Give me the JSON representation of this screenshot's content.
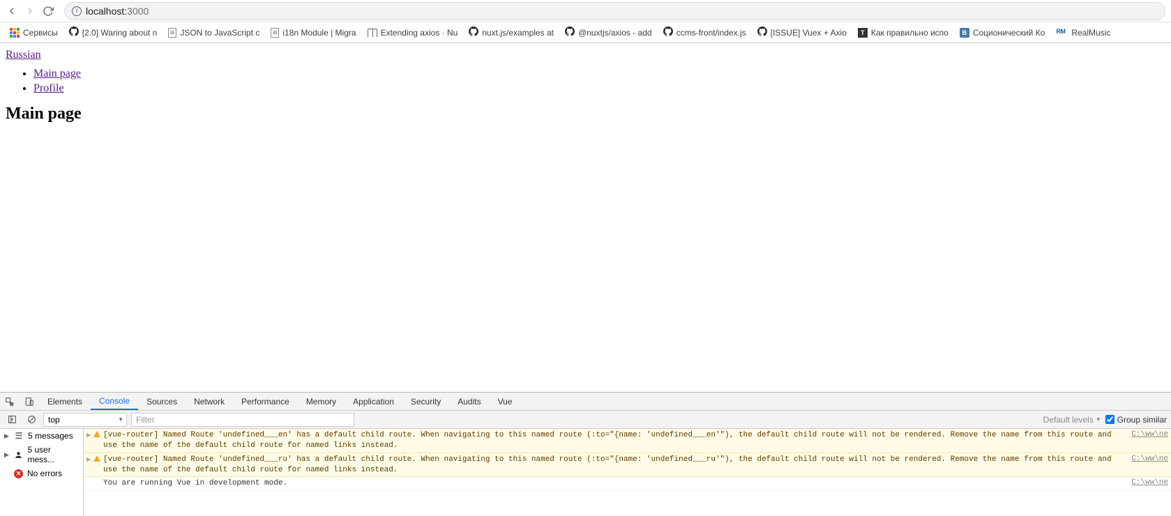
{
  "browser": {
    "url_host": "localhost:",
    "url_port": "3000"
  },
  "bookmarks": [
    {
      "icon": "apps",
      "label": "Сервисы"
    },
    {
      "icon": "github",
      "label": "[2.0] Waring about n"
    },
    {
      "icon": "doc",
      "label": "JSON to JavaScript c"
    },
    {
      "icon": "doc",
      "label": "i18n Module | Migra"
    },
    {
      "icon": "book",
      "label": "Extending axios · Nu"
    },
    {
      "icon": "github",
      "label": "nuxt.js/examples at "
    },
    {
      "icon": "github",
      "label": "@nuxtjs/axios - add"
    },
    {
      "icon": "github",
      "label": "ccms-front/index.js "
    },
    {
      "icon": "github",
      "label": "[ISSUE] Vuex + Axio"
    },
    {
      "icon": "tab",
      "label": "Как правильно испо"
    },
    {
      "icon": "vk",
      "label": "Соционический Ко"
    },
    {
      "icon": "rm",
      "label": "RealMusic"
    }
  ],
  "page": {
    "lang_link": "Russian",
    "nav": [
      {
        "label": "Main page"
      },
      {
        "label": "Profile"
      }
    ],
    "heading": "Main page"
  },
  "devtools": {
    "tabs": [
      "Elements",
      "Console",
      "Sources",
      "Network",
      "Performance",
      "Memory",
      "Application",
      "Security",
      "Audits",
      "Vue"
    ],
    "active_tab": "Console",
    "context": "top",
    "filter_placeholder": "Filter",
    "levels_label": "Default levels",
    "group_similar": "Group similar",
    "sidebar": [
      {
        "icon": "msg",
        "label": "5 messages",
        "arrow": true
      },
      {
        "icon": "user",
        "label": "5 user mess...",
        "arrow": true
      },
      {
        "icon": "err",
        "label": "No errors",
        "arrow": false
      }
    ],
    "logs": [
      {
        "level": "warn",
        "text": "[vue-router] Named Route 'undefined___en' has a default child route. When navigating to this named route (:to=\"{name: 'undefined___en'\"), the default child route will not be rendered. Remove the name from this route and use the name of the default child route for named links instead.",
        "src": "C:\\ww\\ne"
      },
      {
        "level": "warn",
        "text": "[vue-router] Named Route 'undefined___ru' has a default child route. When navigating to this named route (:to=\"{name: 'undefined___ru'\"), the default child route will not be rendered. Remove the name from this route and use the name of the default child route for named links instead.",
        "src": "C:\\ww\\ne"
      },
      {
        "level": "log",
        "text": "You are running Vue in development mode.",
        "src": "C:\\ww\\ne"
      }
    ]
  }
}
